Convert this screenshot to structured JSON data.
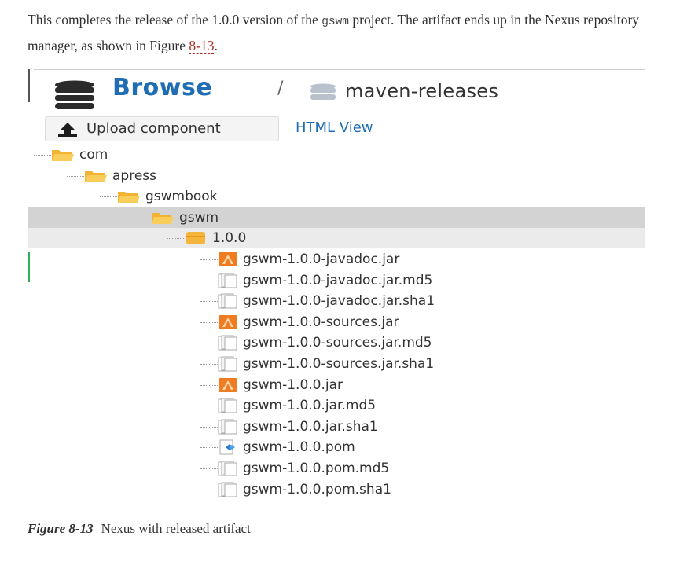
{
  "intro": {
    "p1": "This completes the release of the 1.0.0 version of the ",
    "code": "gswm",
    "p2": " project. The artifact ends up in the Nexus repository manager, as shown in Figure ",
    "link": "8-13",
    "p3": "."
  },
  "figure": {
    "breadcrumb": {
      "title": "Browse",
      "separator": "/",
      "repo": "maven-releases"
    },
    "toolbar": {
      "upload_label": "Upload component",
      "html_view": "HTML View"
    },
    "tree": [
      {
        "label": "com",
        "level": 0,
        "type": "folder"
      },
      {
        "label": "apress",
        "level": 1,
        "type": "folder"
      },
      {
        "label": "gswmbook",
        "level": 2,
        "type": "folder"
      },
      {
        "label": "gswm",
        "level": 3,
        "type": "folder",
        "highlight": "dark"
      },
      {
        "label": "1.0.0",
        "level": 4,
        "type": "version",
        "highlight": "light"
      },
      {
        "label": "gswm-1.0.0-javadoc.jar",
        "level": 5,
        "type": "jar-icon"
      },
      {
        "label": "gswm-1.0.0-javadoc.jar.md5",
        "level": 5,
        "type": "file-icon"
      },
      {
        "label": "gswm-1.0.0-javadoc.jar.sha1",
        "level": 5,
        "type": "file-icon"
      },
      {
        "label": "gswm-1.0.0-sources.jar",
        "level": 5,
        "type": "jar-icon"
      },
      {
        "label": "gswm-1.0.0-sources.jar.md5",
        "level": 5,
        "type": "file-icon"
      },
      {
        "label": "gswm-1.0.0-sources.jar.sha1",
        "level": 5,
        "type": "file-icon"
      },
      {
        "label": "gswm-1.0.0.jar",
        "level": 5,
        "type": "jar-icon"
      },
      {
        "label": "gswm-1.0.0.jar.md5",
        "level": 5,
        "type": "file-icon"
      },
      {
        "label": "gswm-1.0.0.jar.sha1",
        "level": 5,
        "type": "file-icon"
      },
      {
        "label": "gswm-1.0.0.pom",
        "level": 5,
        "type": "pom-icon"
      },
      {
        "label": "gswm-1.0.0.pom.md5",
        "level": 5,
        "type": "file-icon"
      },
      {
        "label": "gswm-1.0.0.pom.sha1",
        "level": 5,
        "type": "file-icon"
      }
    ]
  },
  "caption": {
    "number": "Figure 8-13",
    "text": "Nexus with released artifact"
  }
}
